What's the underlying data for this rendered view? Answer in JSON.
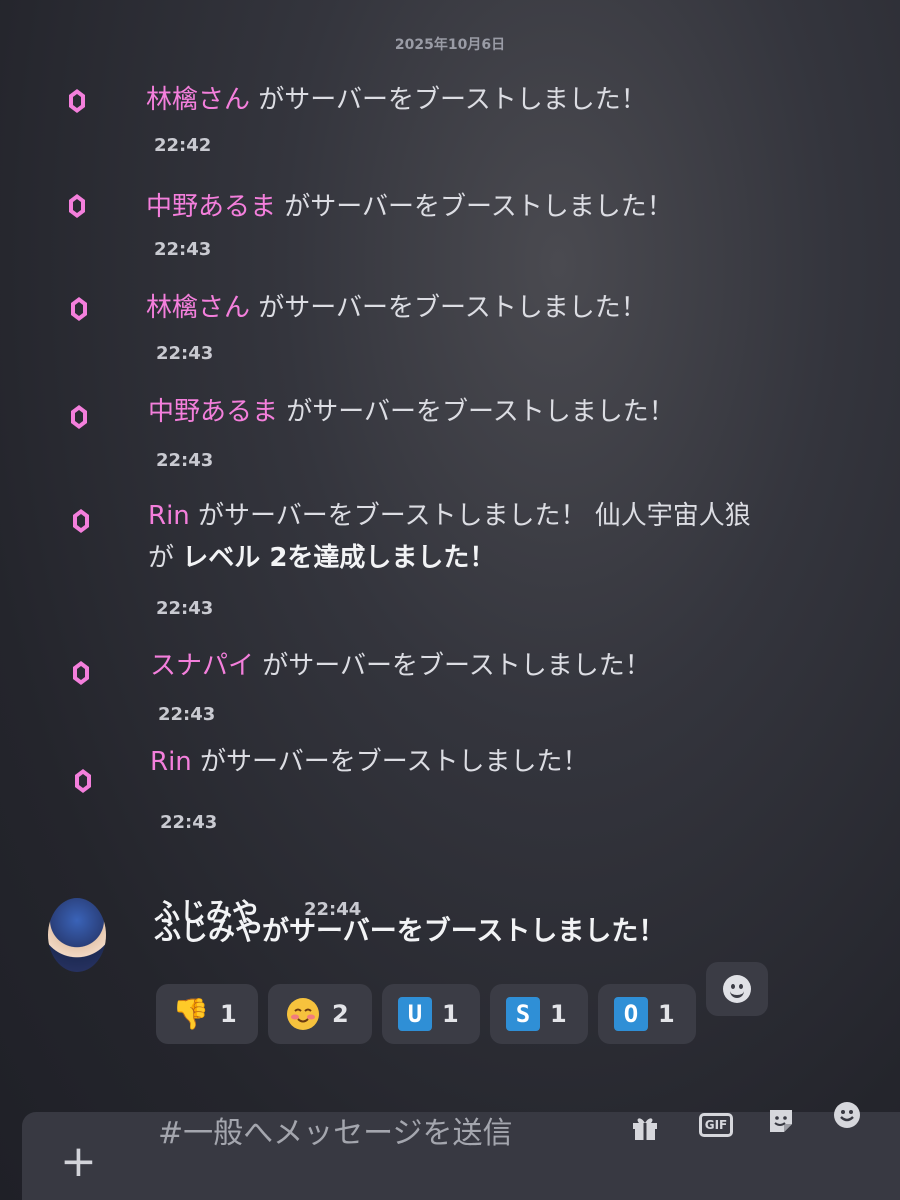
{
  "date_divider": "2025年10月6日",
  "boost_messages": [
    {
      "name": "林檎さん",
      "text": " がサーバーをブーストしました！",
      "time": "22:42"
    },
    {
      "name": "中野あるま",
      "text": " がサーバーをブーストしました！",
      "time": "22:43"
    },
    {
      "name": "林檎さん",
      "text": " がサーバーをブーストしました！",
      "time": "22:43"
    },
    {
      "name": "中野あるま",
      "text": " がサーバーをブーストしました！",
      "time": "22:43"
    },
    {
      "name": "Rin",
      "text": " がサーバーをブーストしました！ 仙人宇宙人狼",
      "line2_prefix": "が ",
      "line2_bold": "レベル 2を達成しました！",
      "time": "22:43"
    },
    {
      "name": "スナパイ",
      "text": " がサーバーをブーストしました！",
      "time": "22:43"
    },
    {
      "name": "Rin",
      "text": " がサーバーをブーストしました！",
      "time": "22:43"
    }
  ],
  "user_message": {
    "author": "ふじみや",
    "time": "22:44",
    "content": "ふじみやがサーバーをブーストしました！"
  },
  "reactions": [
    {
      "emoji": "👎",
      "count": "1",
      "icon": "thumbs-down-icon"
    },
    {
      "emoji": "☺",
      "count": "2",
      "icon": "blushing-face-icon"
    },
    {
      "emoji": "U",
      "count": "1",
      "icon": "regional-u-icon"
    },
    {
      "emoji": "S",
      "count": "1",
      "icon": "regional-s-icon"
    },
    {
      "emoji": "O",
      "count": "1",
      "icon": "regional-o-icon"
    }
  ],
  "composer": {
    "placeholder": "#一般へメッセージを送信",
    "gif_label": "GIF"
  },
  "colors": {
    "accent_name": "#f47fdc",
    "boost_icon": "#f47fdc",
    "regional_indicator": "#2f8fd6"
  }
}
